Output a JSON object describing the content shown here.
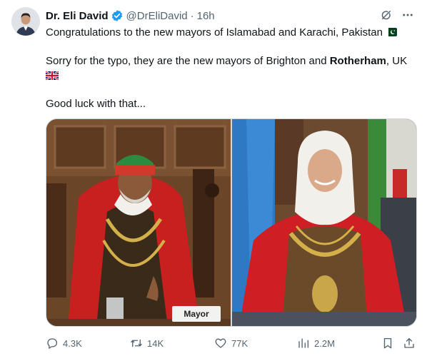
{
  "author": {
    "display_name": "Dr. Eli David",
    "handle": "@DrEliDavid",
    "separator": "·",
    "time": "16h"
  },
  "tweet": {
    "line1": "Congratulations to the new mayors of Islamabad and Karachi, Pakistan",
    "line2_before": "Sorry for the typo, they are the new mayors of Brighton and ",
    "line2_bold": "Rotherham",
    "line2_after": ", UK",
    "line3": "Good luck with that..."
  },
  "media": {
    "left_photo_sign": "Mayor"
  },
  "actions": {
    "replies": "4.3K",
    "retweets": "14K",
    "likes": "77K",
    "views": "2.2M"
  },
  "icons": {
    "verified": "verified-badge-icon",
    "grok": "grok-icon",
    "more": "more-icon",
    "flag_pakistan": "pakistan-flag-icon",
    "flag_uk": "uk-flag-icon",
    "reply": "reply-icon",
    "retweet": "retweet-icon",
    "like": "heart-icon",
    "views": "views-chart-icon",
    "bookmark": "bookmark-icon",
    "share": "share-icon"
  },
  "colors": {
    "verified_blue": "#1d9bf0",
    "text_primary": "#0f1419",
    "text_secondary": "#536471"
  }
}
